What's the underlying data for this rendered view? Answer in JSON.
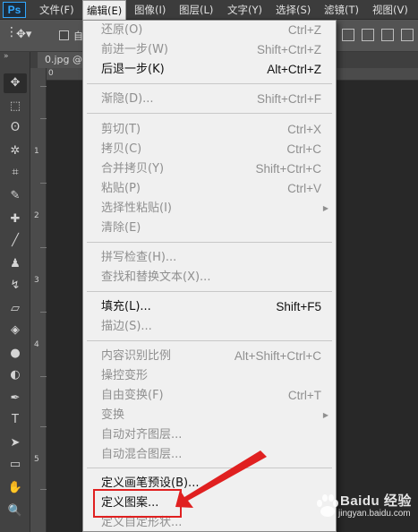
{
  "app": {
    "logo": "Ps"
  },
  "menubar": {
    "items": [
      {
        "label": "文件(F)"
      },
      {
        "label": "编辑(E)"
      },
      {
        "label": "图像(I)"
      },
      {
        "label": "图层(L)"
      },
      {
        "label": "文字(Y)"
      },
      {
        "label": "选择(S)"
      },
      {
        "label": "滤镜(T)"
      },
      {
        "label": "视图(V)"
      }
    ],
    "active": "编辑(E)"
  },
  "options": {
    "auto_select_label": "自"
  },
  "document": {
    "tab_label": "0.jpg @"
  },
  "ruler": {
    "vertical_numbers": [
      "1",
      "2",
      "3",
      "4",
      "5"
    ],
    "horizontal_first": "0"
  },
  "edit_menu": {
    "items": [
      {
        "label": "还原(O)",
        "shortcut": "Ctrl+Z",
        "enabled": false
      },
      {
        "label": "前进一步(W)",
        "shortcut": "Shift+Ctrl+Z",
        "enabled": false
      },
      {
        "label": "后退一步(K)",
        "shortcut": "Alt+Ctrl+Z",
        "enabled": true
      },
      {
        "label": "渐隐(D)...",
        "shortcut": "Shift+Ctrl+F",
        "enabled": false
      },
      {
        "label": "剪切(T)",
        "shortcut": "Ctrl+X",
        "enabled": false
      },
      {
        "label": "拷贝(C)",
        "shortcut": "Ctrl+C",
        "enabled": false
      },
      {
        "label": "合并拷贝(Y)",
        "shortcut": "Shift+Ctrl+C",
        "enabled": false
      },
      {
        "label": "粘贴(P)",
        "shortcut": "Ctrl+V",
        "enabled": false
      },
      {
        "label": "选择性粘贴(I)",
        "shortcut": "",
        "enabled": false,
        "submenu": true
      },
      {
        "label": "清除(E)",
        "shortcut": "",
        "enabled": false
      },
      {
        "label": "拼写检查(H)...",
        "shortcut": "",
        "enabled": false
      },
      {
        "label": "查找和替换文本(X)...",
        "shortcut": "",
        "enabled": false
      },
      {
        "label": "填充(L)...",
        "shortcut": "Shift+F5",
        "enabled": true
      },
      {
        "label": "描边(S)...",
        "shortcut": "",
        "enabled": false
      },
      {
        "label": "内容识别比例",
        "shortcut": "Alt+Shift+Ctrl+C",
        "enabled": false
      },
      {
        "label": "操控变形",
        "shortcut": "",
        "enabled": false
      },
      {
        "label": "自由变换(F)",
        "shortcut": "Ctrl+T",
        "enabled": false
      },
      {
        "label": "变换",
        "shortcut": "",
        "enabled": false,
        "submenu": true
      },
      {
        "label": "自动对齐图层...",
        "shortcut": "",
        "enabled": false
      },
      {
        "label": "自动混合图层...",
        "shortcut": "",
        "enabled": false
      },
      {
        "label": "定义画笔预设(B)...",
        "shortcut": "",
        "enabled": true
      },
      {
        "label": "定义图案...",
        "shortcut": "",
        "enabled": true,
        "highlighted": true
      },
      {
        "label": "定义自定形状...",
        "shortcut": "",
        "enabled": false
      }
    ]
  },
  "watermark": {
    "brand": "Baidu 经验",
    "url": "jingyan.baidu.com"
  },
  "colors": {
    "accent": "#31a8ff",
    "annotation_red": "#e02020",
    "menu_bg": "#f0f0f0"
  }
}
